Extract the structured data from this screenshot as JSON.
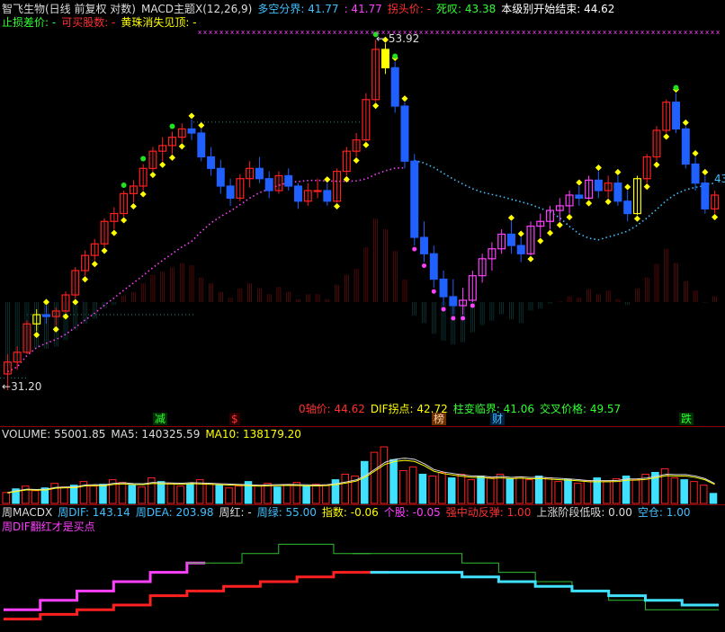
{
  "header": {
    "line1": [
      {
        "text": "智飞生物(日线 前复权 对数)",
        "color": "#dcdcdc"
      },
      {
        "text": "MACD主题X(12,26,9)",
        "color": "#dcdcdc"
      },
      {
        "text": "多空分界: 41.77",
        "color": "#40c0ff"
      },
      {
        "text": ": 41.77",
        "color": "#ff40ff"
      },
      {
        "text": "拐头价: -",
        "color": "#ff3030"
      },
      {
        "text": "死叹: 43.38",
        "color": "#30ff30"
      },
      {
        "text": "本级别开始结束: 44.62",
        "color": "#ffffff"
      }
    ],
    "line2": [
      {
        "text": "止损差价: -",
        "color": "#30ff30"
      },
      {
        "text": "可买股数: -",
        "color": "#ff3030"
      },
      {
        "text": "黄珠消失见顶: -",
        "color": "#ffff00"
      }
    ]
  },
  "main_labels": {
    "high_price": "53.92",
    "low_price": "31.20",
    "right_price": "43",
    "bottom_info": [
      {
        "text": "0轴价: 44.62",
        "color": "#ff3030"
      },
      {
        "text": "DIF拐点: 42.72",
        "color": "#ffff00"
      },
      {
        "text": "柱变临界: 41.06",
        "color": "#30ff30"
      },
      {
        "text": "交叉价格: 49.57",
        "color": "#30ff30"
      }
    ],
    "tags": [
      {
        "text": "减",
        "color": "#30ff30",
        "bg": "#003000"
      },
      {
        "text": "$",
        "color": "#ff3030",
        "bg": "#300000"
      },
      {
        "text": "榜",
        "color": "#ffd0a0",
        "bg": "#6a3000"
      },
      {
        "text": "财",
        "color": "#40c0ff",
        "bg": "#002040"
      },
      {
        "text": "跌",
        "color": "#30ff30",
        "bg": "#003000"
      }
    ]
  },
  "volume_header": [
    {
      "text": "VOLUME: 55001.85",
      "color": "#dcdcdc"
    },
    {
      "text": "MA5: 140325.59",
      "color": "#dcdcdc"
    },
    {
      "text": "MA10: 138179.20",
      "color": "#ffff00"
    }
  ],
  "macd_header": [
    {
      "text": "周MACDX",
      "color": "#dcdcdc"
    },
    {
      "text": "周DIF: 143.14",
      "color": "#40c0ff"
    },
    {
      "text": "周DEA: 203.98",
      "color": "#40c0ff"
    },
    {
      "text": "周红: -",
      "color": "#dcdcdc"
    },
    {
      "text": "周绿: 55.00",
      "color": "#40c0ff"
    },
    {
      "text": "指数: -0.06",
      "color": "#ffff00"
    },
    {
      "text": "个股: -0.05",
      "color": "#ff40ff"
    },
    {
      "text": "强中动反弹: 1.00",
      "color": "#ff3030"
    },
    {
      "text": "上涨阶段低吸: 0.00",
      "color": "#dcdcdc"
    },
    {
      "text": "空仓: 1.00",
      "color": "#40c0ff"
    }
  ],
  "macd_note": {
    "text": "周DIF翻红才是买点",
    "color": "#ff40ff"
  },
  "chart_data": [
    {
      "type": "candlestick",
      "title": "智飞生物(日线 前复权 对数)",
      "price_high": 53.92,
      "price_low": 31.2,
      "ohlc": [
        [
          32.0,
          33.0,
          31.2,
          32.6
        ],
        [
          32.6,
          33.4,
          32.2,
          33.1
        ],
        [
          33.1,
          34.8,
          33.0,
          34.6
        ],
        [
          34.6,
          35.4,
          34.2,
          35.1
        ],
        [
          35.1,
          35.6,
          34.6,
          35.0
        ],
        [
          35.0,
          35.5,
          34.5,
          35.3
        ],
        [
          35.3,
          36.4,
          35.2,
          36.2
        ],
        [
          36.2,
          37.8,
          36.0,
          37.6
        ],
        [
          37.6,
          38.8,
          37.3,
          38.5
        ],
        [
          38.5,
          39.5,
          38.2,
          39.2
        ],
        [
          39.2,
          40.8,
          39.0,
          40.6
        ],
        [
          40.6,
          41.5,
          40.1,
          41.1
        ],
        [
          41.1,
          42.6,
          40.9,
          42.4
        ],
        [
          42.4,
          43.3,
          41.8,
          42.9
        ],
        [
          42.9,
          44.4,
          42.6,
          44.1
        ],
        [
          44.1,
          45.6,
          43.9,
          45.3
        ],
        [
          45.3,
          46.3,
          44.6,
          45.7
        ],
        [
          45.7,
          46.7,
          45.1,
          46.3
        ],
        [
          46.3,
          47.3,
          45.9,
          46.9
        ],
        [
          46.9,
          47.6,
          46.1,
          46.6
        ],
        [
          46.6,
          46.9,
          44.6,
          44.9
        ],
        [
          44.9,
          45.6,
          43.6,
          44.1
        ],
        [
          44.1,
          44.7,
          42.4,
          42.9
        ],
        [
          42.9,
          43.4,
          41.6,
          42.1
        ],
        [
          42.1,
          43.7,
          41.9,
          43.4
        ],
        [
          43.4,
          44.6,
          42.8,
          44.1
        ],
        [
          44.1,
          44.9,
          43.1,
          43.4
        ],
        [
          43.4,
          43.9,
          42.1,
          42.6
        ],
        [
          42.6,
          43.9,
          42.4,
          43.6
        ],
        [
          43.6,
          44.1,
          42.6,
          42.9
        ],
        [
          42.9,
          43.1,
          41.4,
          41.9
        ],
        [
          41.9,
          43.1,
          41.6,
          42.6
        ],
        [
          42.6,
          43.4,
          42.1,
          42.6
        ],
        [
          42.6,
          43.1,
          41.6,
          41.9
        ],
        [
          41.9,
          44.1,
          41.8,
          43.9
        ],
        [
          43.9,
          45.6,
          43.6,
          45.3
        ],
        [
          45.3,
          46.6,
          44.9,
          46.1
        ],
        [
          46.1,
          49.6,
          46.0,
          49.1
        ],
        [
          49.1,
          53.9,
          48.9,
          53.1
        ],
        [
          53.1,
          53.6,
          51.1,
          51.6
        ],
        [
          51.6,
          52.1,
          48.1,
          48.6
        ],
        [
          48.6,
          48.9,
          44.1,
          44.6
        ],
        [
          44.6,
          45.1,
          39.1,
          39.6
        ],
        [
          39.6,
          40.6,
          38.1,
          38.6
        ],
        [
          38.6,
          39.1,
          36.6,
          37.1
        ],
        [
          37.1,
          37.6,
          35.6,
          36.1
        ],
        [
          36.1,
          37.1,
          35.1,
          35.6
        ],
        [
          35.6,
          36.6,
          35.1,
          35.9
        ],
        [
          35.9,
          37.6,
          35.8,
          37.3
        ],
        [
          37.3,
          38.6,
          36.9,
          38.3
        ],
        [
          38.3,
          39.3,
          37.6,
          38.9
        ],
        [
          38.9,
          40.1,
          38.6,
          39.8
        ],
        [
          39.8,
          40.6,
          38.6,
          39.1
        ],
        [
          39.1,
          39.6,
          38.1,
          38.6
        ],
        [
          38.6,
          40.6,
          38.5,
          40.3
        ],
        [
          40.3,
          41.1,
          39.6,
          40.6
        ],
        [
          40.6,
          41.6,
          40.1,
          41.3
        ],
        [
          41.3,
          42.1,
          40.6,
          41.6
        ],
        [
          41.6,
          42.6,
          41.1,
          42.3
        ],
        [
          42.3,
          42.9,
          41.6,
          42.1
        ],
        [
          42.1,
          43.6,
          42.0,
          43.3
        ],
        [
          43.3,
          43.9,
          42.1,
          42.6
        ],
        [
          42.6,
          43.6,
          42.1,
          43.1
        ],
        [
          43.1,
          43.6,
          41.6,
          41.9
        ],
        [
          41.9,
          42.6,
          40.6,
          41.1
        ],
        [
          41.1,
          43.6,
          41.0,
          43.4
        ],
        [
          43.4,
          45.1,
          43.1,
          44.9
        ],
        [
          44.9,
          47.1,
          44.6,
          46.8
        ],
        [
          46.8,
          49.1,
          46.6,
          48.9
        ],
        [
          48.9,
          49.6,
          46.6,
          46.9
        ],
        [
          46.9,
          47.1,
          44.1,
          44.4
        ],
        [
          44.4,
          44.9,
          42.6,
          43.1
        ],
        [
          43.1,
          43.6,
          41.1,
          41.4
        ],
        [
          41.4,
          42.6,
          41.1,
          42.3
        ]
      ]
    },
    {
      "type": "bar",
      "title": "VOLUME",
      "series": [
        {
          "name": "VOLUME",
          "values": [
            60,
            80,
            95,
            70,
            85,
            110,
            90,
            100,
            120,
            95,
            105,
            130,
            115,
            100,
            90,
            140,
            120,
            110,
            95,
            105,
            130,
            110,
            100,
            85,
            95,
            120,
            100,
            110,
            90,
            100,
            115,
            95,
            105,
            100,
            130,
            160,
            150,
            230,
            280,
            310,
            240,
            180,
            200,
            160,
            150,
            170,
            140,
            160,
            130,
            150,
            140,
            160,
            135,
            145,
            130,
            150,
            140,
            120,
            130,
            110,
            125,
            140,
            120,
            135,
            150,
            130,
            160,
            170,
            190,
            140,
            130,
            120,
            100,
            55
          ]
        },
        {
          "name": "MA5",
          "values": []
        },
        {
          "name": "MA10",
          "values": []
        }
      ]
    },
    {
      "type": "line",
      "title": "周MACDX",
      "series": [
        {
          "name": "周DIF",
          "values": [
            4,
            4,
            6,
            6,
            8,
            8,
            10,
            10,
            12,
            12,
            14,
            14,
            14,
            16,
            16,
            18,
            18,
            18,
            16,
            16,
            16,
            16,
            16,
            16,
            16,
            14,
            14,
            12,
            12,
            10,
            10,
            8,
            8,
            6,
            6,
            4,
            4,
            4,
            4
          ]
        },
        {
          "name": "周DEA",
          "values": [
            2,
            2,
            3,
            3,
            4,
            4,
            5,
            5,
            7,
            7,
            8,
            8,
            9,
            9,
            10,
            10,
            11,
            11,
            12,
            12,
            12,
            12,
            12,
            12,
            12,
            11,
            11,
            10,
            10,
            9,
            9,
            8,
            8,
            7,
            7,
            6,
            6,
            5,
            5
          ]
        }
      ]
    }
  ]
}
